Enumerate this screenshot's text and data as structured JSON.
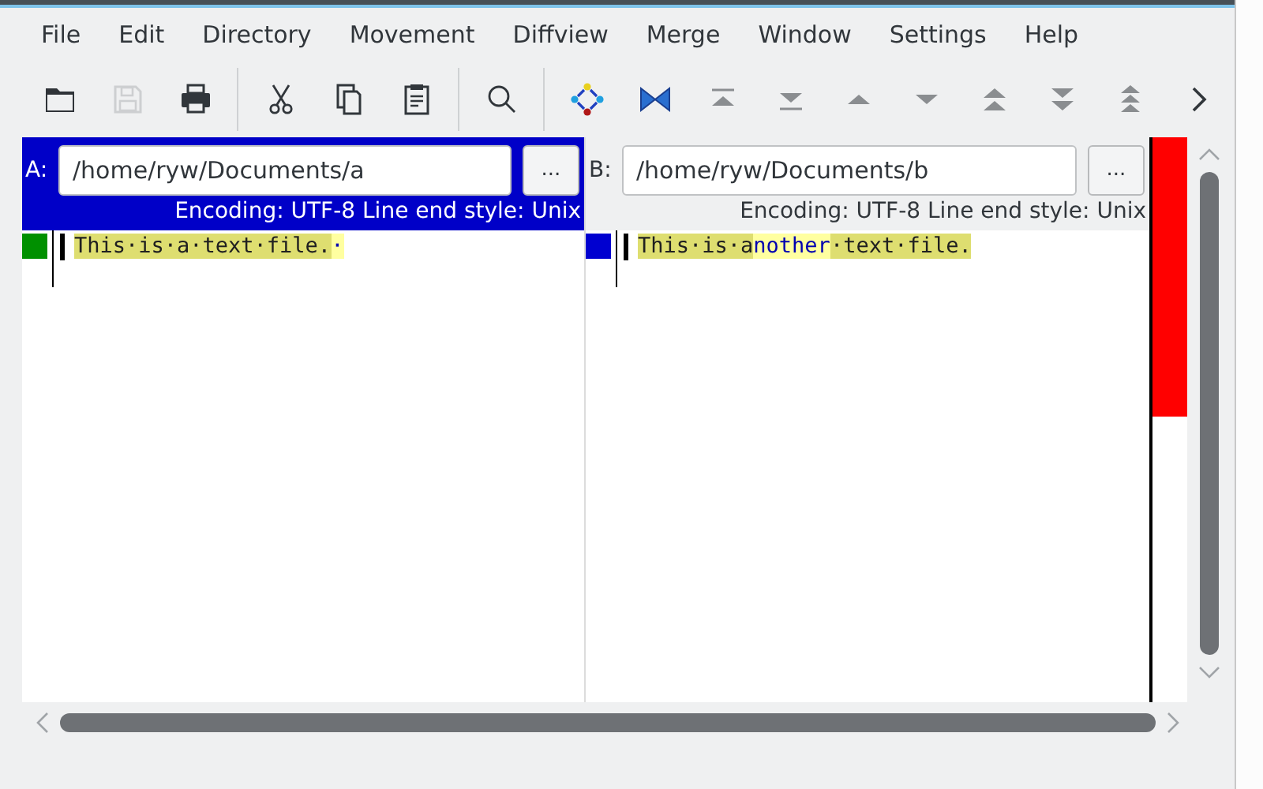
{
  "menu": [
    "File",
    "Edit",
    "Directory",
    "Movement",
    "Diffview",
    "Merge",
    "Window",
    "Settings",
    "Help"
  ],
  "toolbar": [
    {
      "kind": "open",
      "disabled": false
    },
    {
      "kind": "save",
      "disabled": true
    },
    {
      "kind": "print",
      "disabled": false
    },
    {
      "kind": "separator"
    },
    {
      "kind": "cut",
      "disabled": false
    },
    {
      "kind": "copy",
      "disabled": false
    },
    {
      "kind": "paste",
      "disabled": false
    },
    {
      "kind": "separator"
    },
    {
      "kind": "search",
      "disabled": false
    },
    {
      "kind": "separator"
    },
    {
      "kind": "center",
      "disabled": false
    },
    {
      "kind": "bowtie",
      "disabled": false
    },
    {
      "kind": "first",
      "disabled": false
    },
    {
      "kind": "last",
      "disabled": false
    },
    {
      "kind": "up",
      "disabled": false
    },
    {
      "kind": "down",
      "disabled": false
    },
    {
      "kind": "double-up",
      "disabled": false
    },
    {
      "kind": "double-down",
      "disabled": false
    },
    {
      "kind": "triple-up",
      "disabled": false
    },
    {
      "kind": "more",
      "disabled": false
    }
  ],
  "panes": [
    {
      "label": "A:",
      "path": "/home/ryw/Documents/a",
      "browse": "...",
      "status": "Encoding: UTF-8 Line end style: Unix",
      "active": true,
      "color": "#009000",
      "lines": [
        [
          {
            "text": "This·is·a·text·file.",
            "kind": "same"
          },
          {
            "text": "·",
            "kind": "diff"
          }
        ]
      ]
    },
    {
      "label": "B:",
      "path": "/home/ryw/Documents/b",
      "browse": "...",
      "status": "Encoding: UTF-8 Line end style: Unix",
      "active": false,
      "color": "#0000d0",
      "lines": [
        [
          {
            "text": "This·is·a",
            "kind": "same"
          },
          {
            "text": "nother",
            "kind": "diff"
          },
          {
            "text": "·text·file.",
            "kind": "same"
          }
        ]
      ]
    }
  ]
}
